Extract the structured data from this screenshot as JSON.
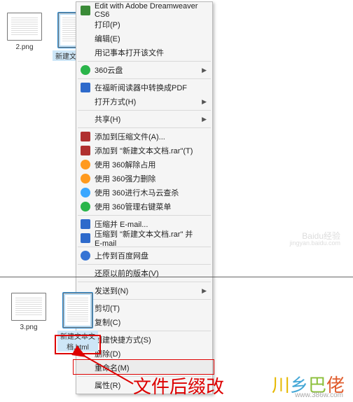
{
  "files_top": [
    {
      "label": "2.png",
      "landscape": true
    },
    {
      "label": "新建文本文"
    }
  ],
  "files_bottom": [
    {
      "label": "3.png",
      "landscape": true
    },
    {
      "label": "新建文本文\n档.html"
    }
  ],
  "menu": [
    {
      "type": "item",
      "label": "Edit with Adobe Dreamweaver CS6",
      "icon": "sw-dw"
    },
    {
      "type": "item",
      "label": "打印(P)"
    },
    {
      "type": "item",
      "label": "编辑(E)"
    },
    {
      "type": "item",
      "label": "用记事本打开该文件"
    },
    {
      "type": "sep"
    },
    {
      "type": "item",
      "label": "360云盘",
      "icon": "sw-360",
      "sub": true
    },
    {
      "type": "sep"
    },
    {
      "type": "item",
      "label": "在福昕阅读器中转换成PDF",
      "icon": "sw-pdf"
    },
    {
      "type": "item",
      "label": "打开方式(H)",
      "sub": true
    },
    {
      "type": "sep"
    },
    {
      "type": "item",
      "label": "共享(H)",
      "sub": true
    },
    {
      "type": "sep"
    },
    {
      "type": "item",
      "label": "添加到压缩文件(A)...",
      "icon": "sw-zipR"
    },
    {
      "type": "item",
      "label": "添加到 \"新建文本文档.rar\"(T)",
      "icon": "sw-zipR"
    },
    {
      "type": "item",
      "label": "使用 360解除占用",
      "icon": "sw-360o"
    },
    {
      "type": "item",
      "label": "使用 360强力删除",
      "icon": "sw-360o"
    },
    {
      "type": "item",
      "label": "使用 360进行木马云查杀",
      "icon": "sw-ball"
    },
    {
      "type": "item",
      "label": "使用 360管理右键菜单",
      "icon": "sw-360g"
    },
    {
      "type": "sep"
    },
    {
      "type": "item",
      "label": "压缩并 E-mail...",
      "icon": "sw-zipB"
    },
    {
      "type": "item",
      "label": "压缩到 \"新建文本文档.rar\" 并 E-mail",
      "icon": "sw-zipB"
    },
    {
      "type": "sep"
    },
    {
      "type": "item",
      "label": "上传到百度网盘",
      "icon": "sw-baidu"
    },
    {
      "type": "sep"
    },
    {
      "type": "item",
      "label": "还原以前的版本(V)"
    },
    {
      "type": "sep"
    },
    {
      "type": "item",
      "label": "发送到(N)",
      "sub": true
    },
    {
      "type": "sep"
    },
    {
      "type": "item",
      "label": "剪切(T)"
    },
    {
      "type": "item",
      "label": "复制(C)"
    },
    {
      "type": "sep"
    },
    {
      "type": "item",
      "label": "创建快捷方式(S)"
    },
    {
      "type": "item",
      "label": "删除(D)"
    },
    {
      "type": "item",
      "label": "重命名(M)",
      "highlight": true
    },
    {
      "type": "sep"
    },
    {
      "type": "item",
      "label": "属性(R)"
    }
  ],
  "annotation_text": "文件后缀改",
  "watermark_top": "Baidu经验",
  "watermark_bottom": "jingyan.baidu.com",
  "brand_logo": "川乡巴佬",
  "brand_url": "www.386w.com"
}
